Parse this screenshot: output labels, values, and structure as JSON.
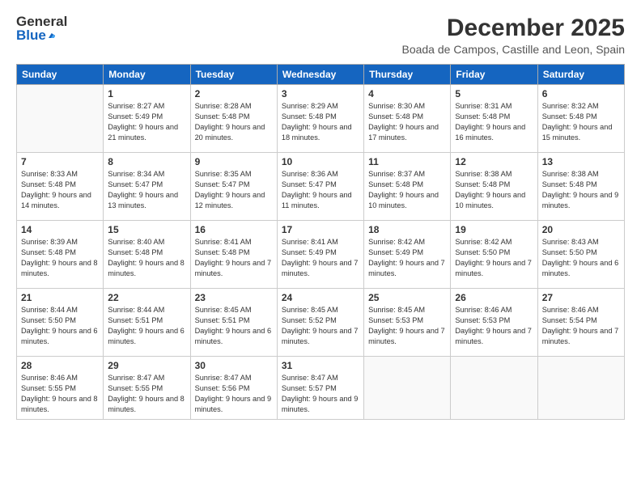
{
  "header": {
    "logo_general": "General",
    "logo_blue": "Blue",
    "month_title": "December 2025",
    "location": "Boada de Campos, Castille and Leon, Spain"
  },
  "weekdays": [
    "Sunday",
    "Monday",
    "Tuesday",
    "Wednesday",
    "Thursday",
    "Friday",
    "Saturday"
  ],
  "weeks": [
    [
      {
        "day": "",
        "sunrise": "",
        "sunset": "",
        "daylight": ""
      },
      {
        "day": "1",
        "sunrise": "Sunrise: 8:27 AM",
        "sunset": "Sunset: 5:49 PM",
        "daylight": "Daylight: 9 hours and 21 minutes."
      },
      {
        "day": "2",
        "sunrise": "Sunrise: 8:28 AM",
        "sunset": "Sunset: 5:48 PM",
        "daylight": "Daylight: 9 hours and 20 minutes."
      },
      {
        "day": "3",
        "sunrise": "Sunrise: 8:29 AM",
        "sunset": "Sunset: 5:48 PM",
        "daylight": "Daylight: 9 hours and 18 minutes."
      },
      {
        "day": "4",
        "sunrise": "Sunrise: 8:30 AM",
        "sunset": "Sunset: 5:48 PM",
        "daylight": "Daylight: 9 hours and 17 minutes."
      },
      {
        "day": "5",
        "sunrise": "Sunrise: 8:31 AM",
        "sunset": "Sunset: 5:48 PM",
        "daylight": "Daylight: 9 hours and 16 minutes."
      },
      {
        "day": "6",
        "sunrise": "Sunrise: 8:32 AM",
        "sunset": "Sunset: 5:48 PM",
        "daylight": "Daylight: 9 hours and 15 minutes."
      }
    ],
    [
      {
        "day": "7",
        "sunrise": "Sunrise: 8:33 AM",
        "sunset": "Sunset: 5:48 PM",
        "daylight": "Daylight: 9 hours and 14 minutes."
      },
      {
        "day": "8",
        "sunrise": "Sunrise: 8:34 AM",
        "sunset": "Sunset: 5:47 PM",
        "daylight": "Daylight: 9 hours and 13 minutes."
      },
      {
        "day": "9",
        "sunrise": "Sunrise: 8:35 AM",
        "sunset": "Sunset: 5:47 PM",
        "daylight": "Daylight: 9 hours and 12 minutes."
      },
      {
        "day": "10",
        "sunrise": "Sunrise: 8:36 AM",
        "sunset": "Sunset: 5:47 PM",
        "daylight": "Daylight: 9 hours and 11 minutes."
      },
      {
        "day": "11",
        "sunrise": "Sunrise: 8:37 AM",
        "sunset": "Sunset: 5:48 PM",
        "daylight": "Daylight: 9 hours and 10 minutes."
      },
      {
        "day": "12",
        "sunrise": "Sunrise: 8:38 AM",
        "sunset": "Sunset: 5:48 PM",
        "daylight": "Daylight: 9 hours and 10 minutes."
      },
      {
        "day": "13",
        "sunrise": "Sunrise: 8:38 AM",
        "sunset": "Sunset: 5:48 PM",
        "daylight": "Daylight: 9 hours and 9 minutes."
      }
    ],
    [
      {
        "day": "14",
        "sunrise": "Sunrise: 8:39 AM",
        "sunset": "Sunset: 5:48 PM",
        "daylight": "Daylight: 9 hours and 8 minutes."
      },
      {
        "day": "15",
        "sunrise": "Sunrise: 8:40 AM",
        "sunset": "Sunset: 5:48 PM",
        "daylight": "Daylight: 9 hours and 8 minutes."
      },
      {
        "day": "16",
        "sunrise": "Sunrise: 8:41 AM",
        "sunset": "Sunset: 5:48 PM",
        "daylight": "Daylight: 9 hours and 7 minutes."
      },
      {
        "day": "17",
        "sunrise": "Sunrise: 8:41 AM",
        "sunset": "Sunset: 5:49 PM",
        "daylight": "Daylight: 9 hours and 7 minutes."
      },
      {
        "day": "18",
        "sunrise": "Sunrise: 8:42 AM",
        "sunset": "Sunset: 5:49 PM",
        "daylight": "Daylight: 9 hours and 7 minutes."
      },
      {
        "day": "19",
        "sunrise": "Sunrise: 8:42 AM",
        "sunset": "Sunset: 5:50 PM",
        "daylight": "Daylight: 9 hours and 7 minutes."
      },
      {
        "day": "20",
        "sunrise": "Sunrise: 8:43 AM",
        "sunset": "Sunset: 5:50 PM",
        "daylight": "Daylight: 9 hours and 6 minutes."
      }
    ],
    [
      {
        "day": "21",
        "sunrise": "Sunrise: 8:44 AM",
        "sunset": "Sunset: 5:50 PM",
        "daylight": "Daylight: 9 hours and 6 minutes."
      },
      {
        "day": "22",
        "sunrise": "Sunrise: 8:44 AM",
        "sunset": "Sunset: 5:51 PM",
        "daylight": "Daylight: 9 hours and 6 minutes."
      },
      {
        "day": "23",
        "sunrise": "Sunrise: 8:45 AM",
        "sunset": "Sunset: 5:51 PM",
        "daylight": "Daylight: 9 hours and 6 minutes."
      },
      {
        "day": "24",
        "sunrise": "Sunrise: 8:45 AM",
        "sunset": "Sunset: 5:52 PM",
        "daylight": "Daylight: 9 hours and 7 minutes."
      },
      {
        "day": "25",
        "sunrise": "Sunrise: 8:45 AM",
        "sunset": "Sunset: 5:53 PM",
        "daylight": "Daylight: 9 hours and 7 minutes."
      },
      {
        "day": "26",
        "sunrise": "Sunrise: 8:46 AM",
        "sunset": "Sunset: 5:53 PM",
        "daylight": "Daylight: 9 hours and 7 minutes."
      },
      {
        "day": "27",
        "sunrise": "Sunrise: 8:46 AM",
        "sunset": "Sunset: 5:54 PM",
        "daylight": "Daylight: 9 hours and 7 minutes."
      }
    ],
    [
      {
        "day": "28",
        "sunrise": "Sunrise: 8:46 AM",
        "sunset": "Sunset: 5:55 PM",
        "daylight": "Daylight: 9 hours and 8 minutes."
      },
      {
        "day": "29",
        "sunrise": "Sunrise: 8:47 AM",
        "sunset": "Sunset: 5:55 PM",
        "daylight": "Daylight: 9 hours and 8 minutes."
      },
      {
        "day": "30",
        "sunrise": "Sunrise: 8:47 AM",
        "sunset": "Sunset: 5:56 PM",
        "daylight": "Daylight: 9 hours and 9 minutes."
      },
      {
        "day": "31",
        "sunrise": "Sunrise: 8:47 AM",
        "sunset": "Sunset: 5:57 PM",
        "daylight": "Daylight: 9 hours and 9 minutes."
      },
      {
        "day": "",
        "sunrise": "",
        "sunset": "",
        "daylight": ""
      },
      {
        "day": "",
        "sunrise": "",
        "sunset": "",
        "daylight": ""
      },
      {
        "day": "",
        "sunrise": "",
        "sunset": "",
        "daylight": ""
      }
    ]
  ]
}
